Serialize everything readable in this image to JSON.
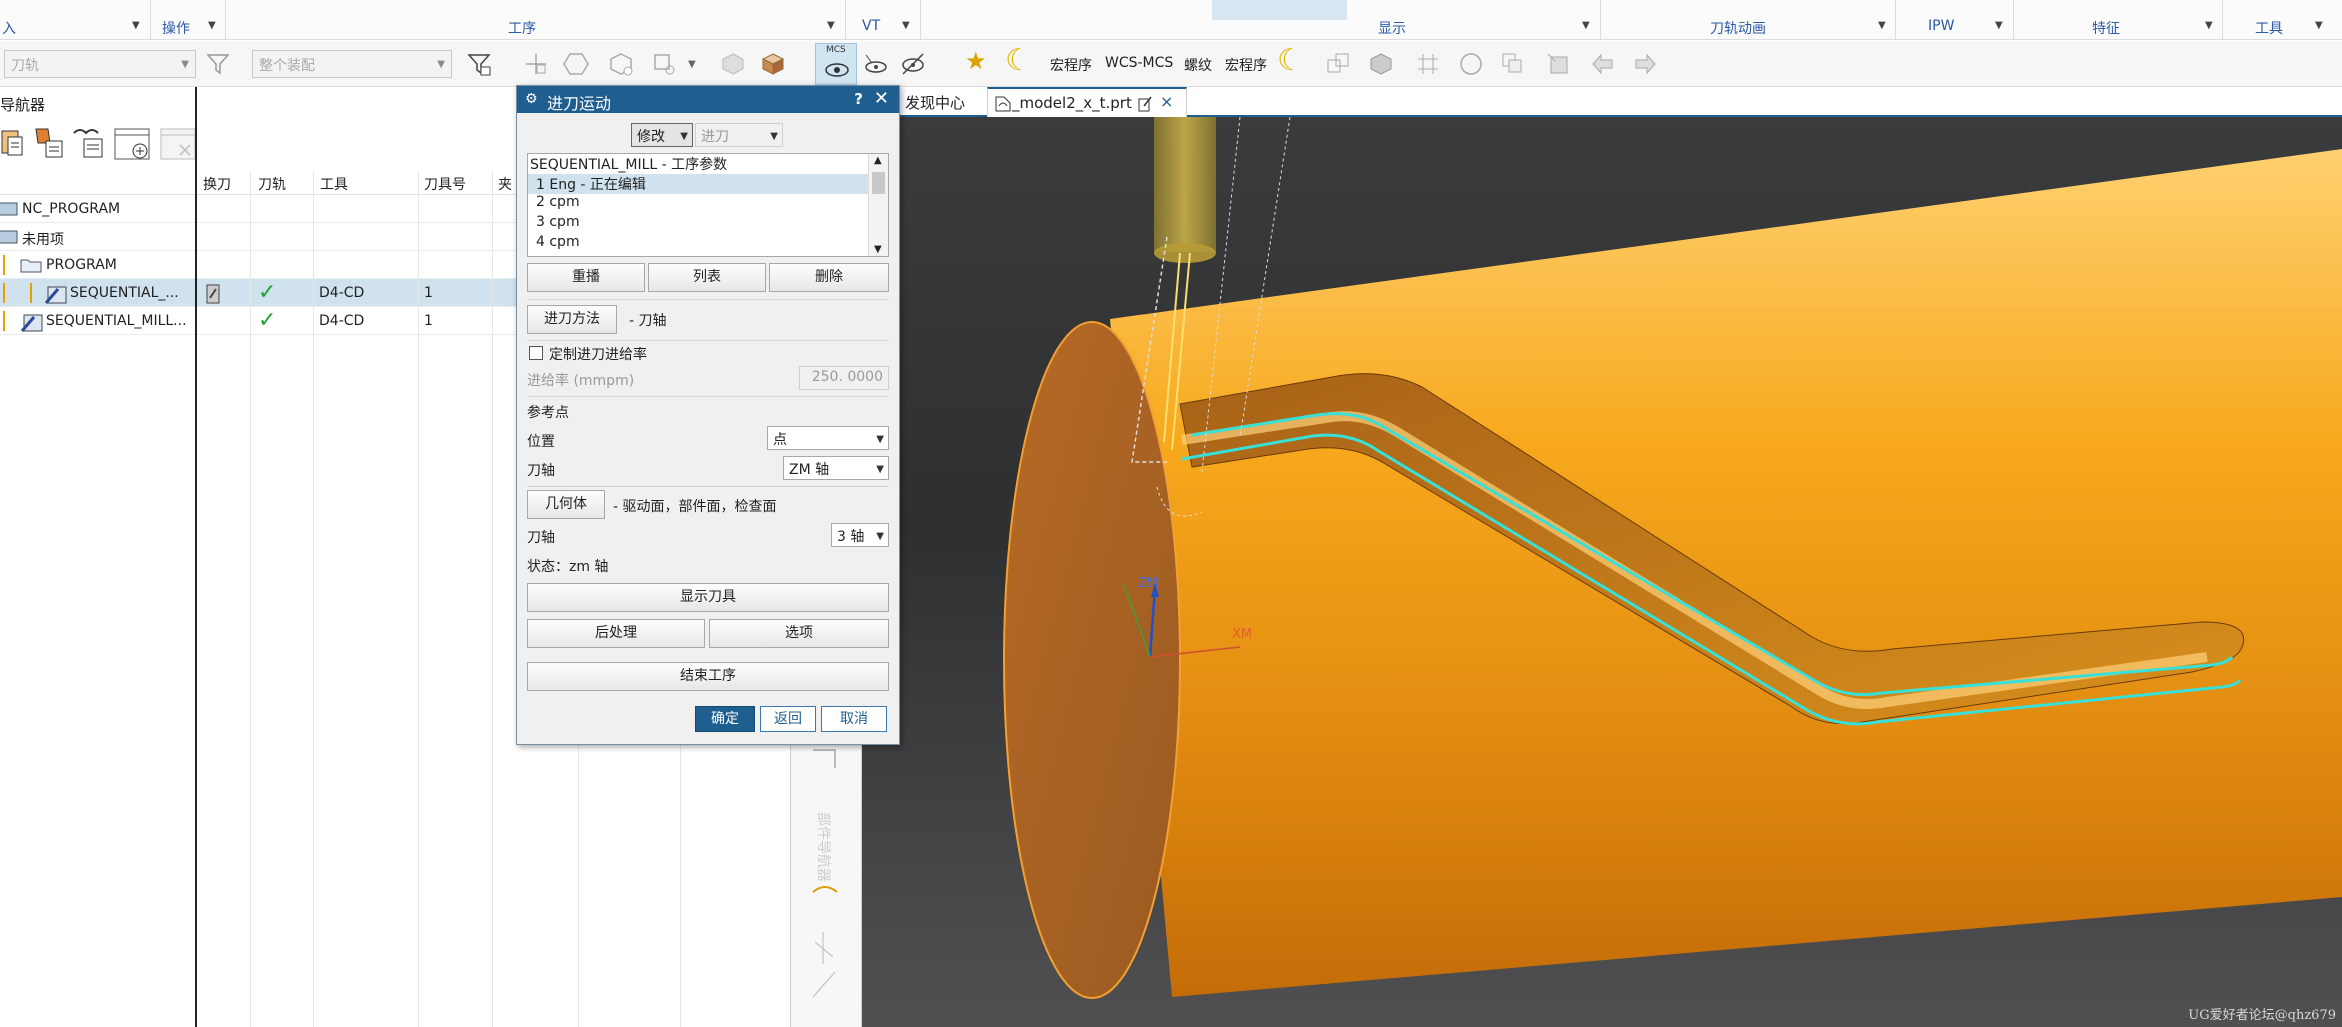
{
  "ribbon": {
    "groups": {
      "insert": "入",
      "operations": "操作",
      "operation": "工序",
      "vt": "VT",
      "display": "显示",
      "tool_animation": "刀轨动画",
      "ipw": "IPW",
      "feature": "特征",
      "tools": "工具"
    }
  },
  "toolbar": {
    "toolpath_filter": "刀轨",
    "assembly_filter": "整个装配",
    "mcs_badge": "MCS",
    "macro_1": "宏程序",
    "wcs_mcs": "WCS-MCS",
    "thread": "螺纹",
    "macro_2": "宏程序"
  },
  "navigator": {
    "title": "导航器",
    "columns": {
      "tool_change": "换刀",
      "toolpath": "刀轨",
      "tool": "工具",
      "tool_number": "刀具号",
      "fixture": "夹"
    },
    "rows": [
      {
        "name": "NC_PROGRAM",
        "tool": "",
        "tool_number": ""
      },
      {
        "name": "未用项",
        "tool": "",
        "tool_number": ""
      },
      {
        "name": "PROGRAM",
        "tool": "",
        "tool_number": ""
      },
      {
        "name": "SEQUENTIAL_...",
        "tool": "D4-CD",
        "tool_number": "1"
      },
      {
        "name": "SEQUENTIAL_MILL...",
        "tool": "D4-CD",
        "tool_number": "1"
      }
    ]
  },
  "tabs": {
    "discovery": "发现中心",
    "part": "_model2_x_t.prt"
  },
  "dialog": {
    "title": "进刀运动",
    "help": "?",
    "mode_selected": "修改",
    "mode2_selected": "进刀",
    "events_header": "SEQUENTIAL_MILL - 工序参数",
    "events": [
      "1  Eng  - 正在编辑",
      "2  cpm",
      "3  cpm",
      "4  cpm"
    ],
    "replay": "重播",
    "list": "列表",
    "delete": "删除",
    "engage_method_btn": "进刀方法",
    "engage_method_desc": "- 刀轴",
    "custom_feed_label": "定制进刀进给率",
    "feed_label": "进给率 (mmpm)",
    "feed_value": "250. 0000",
    "ref_point_label": "参考点",
    "position_label": "位置",
    "position_value": "点",
    "tool_axis_label": "刀轴",
    "tool_axis_value": "ZM 轴",
    "geometry_btn": "几何体",
    "geometry_desc": "- 驱动面，部件面，检查面",
    "tool_axis2_label": "刀轴",
    "tool_axis2_value": "3 轴",
    "status": "状态：zm 轴",
    "show_tool": "显示刀具",
    "post_process": "后处理",
    "options": "选项",
    "end_operation": "结束工序",
    "ok": "确定",
    "back": "返回",
    "cancel": "取消"
  },
  "viewport": {
    "axis_z": "ZM",
    "axis_x": "XM"
  },
  "watermark": "UG爱好者论坛@qhz679",
  "colors": {
    "title_bar": "#1e5f8f",
    "part_orange": "#f0a020",
    "toolpath": "#38e0d8",
    "checkmark": "#22a538"
  }
}
